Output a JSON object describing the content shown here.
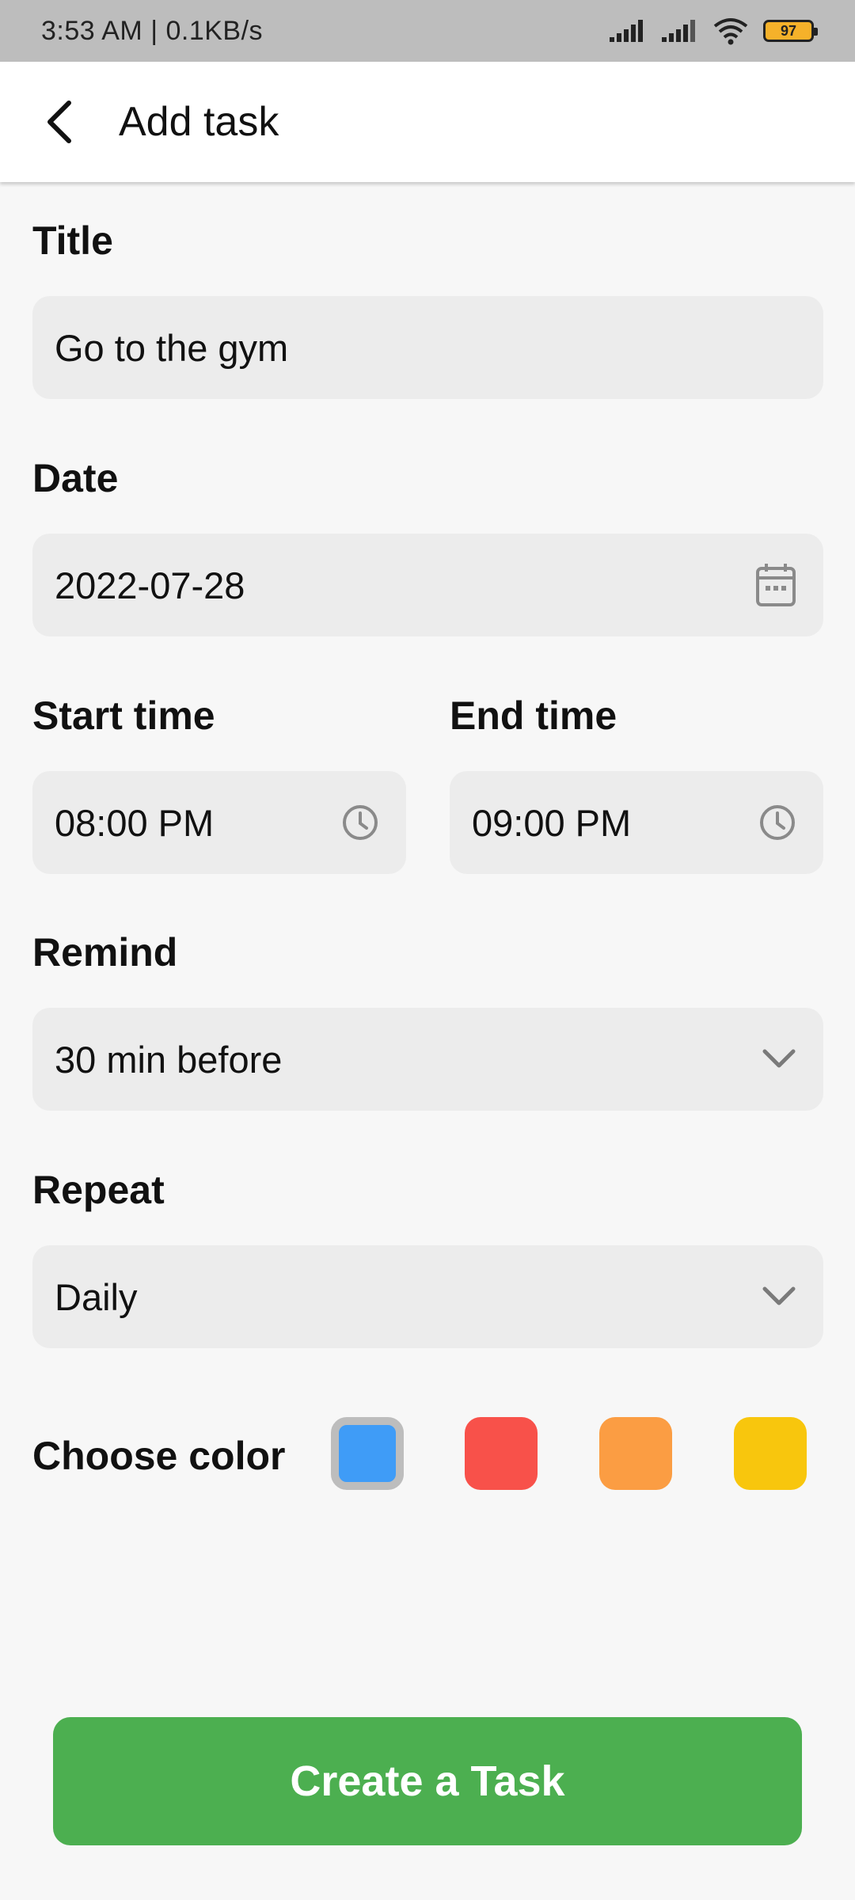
{
  "status_bar": {
    "time": "3:53 AM | 0.1KB/s",
    "battery": "97"
  },
  "header": {
    "title": "Add task"
  },
  "form": {
    "title_label": "Title",
    "title_value": "Go to the gym",
    "date_label": "Date",
    "date_value": "2022-07-28",
    "start_time_label": "Start time",
    "start_time_value": "08:00 PM",
    "end_time_label": "End time",
    "end_time_value": "09:00 PM",
    "remind_label": "Remind",
    "remind_value": "30 min before",
    "repeat_label": "Repeat",
    "repeat_value": "Daily",
    "color_label": "Choose color",
    "colors": [
      "#3f9cf7",
      "#f8514a",
      "#fb9d43",
      "#f8c60d"
    ],
    "selected_color_index": 0
  },
  "action": {
    "create_label": "Create a Task",
    "button_color": "#4caf50"
  },
  "icons": {
    "back": "back-arrow-icon",
    "date": "calendar-icon",
    "time": "clock-icon",
    "dropdown": "chevron-down-icon"
  }
}
